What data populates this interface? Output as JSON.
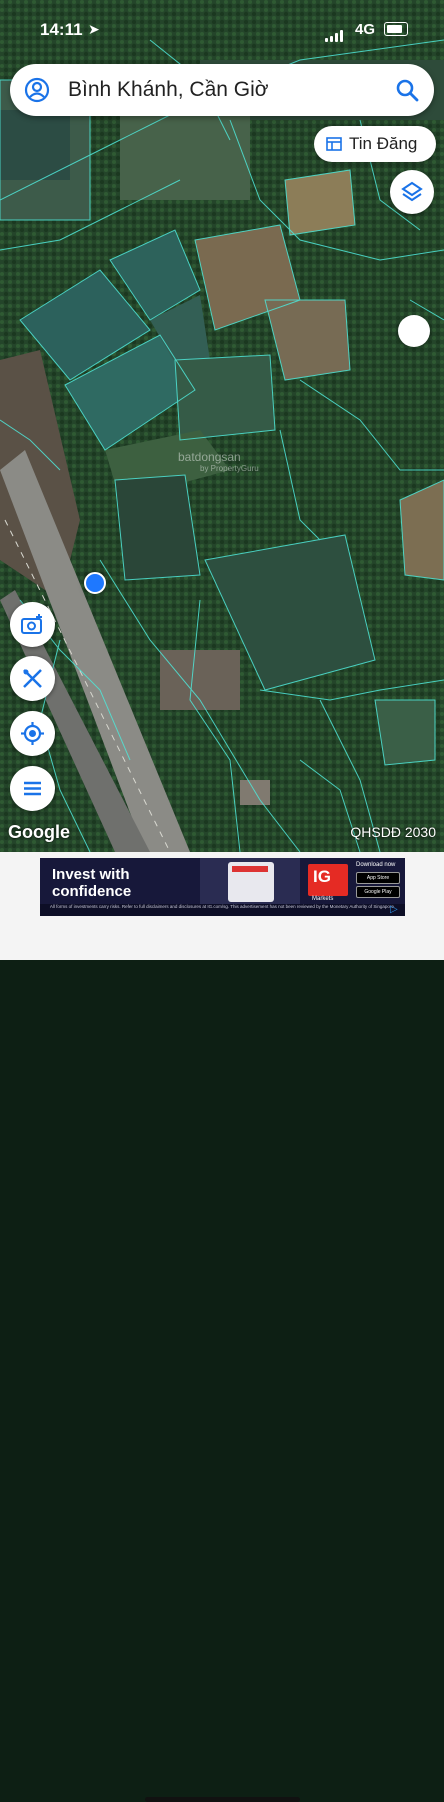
{
  "status_bar": {
    "time": "14:11",
    "network": "4G"
  },
  "search": {
    "query": "Bình Khánh, Cần Giờ"
  },
  "tin_dang_button": {
    "label": "Tin Đăng"
  },
  "map": {
    "attribution": "Google",
    "overlay_label": "QHSDĐ 2030",
    "watermark": "batdongsan",
    "watermark_sub": "by PropertyGuru",
    "boundary_color": "#4fe6d8"
  },
  "fabs": [
    {
      "name": "camera-add-icon"
    },
    {
      "name": "measure-tool-icon"
    },
    {
      "name": "my-location-icon"
    },
    {
      "name": "menu-icon"
    }
  ],
  "ad": {
    "headline": "Invest with confidence",
    "brand": "IG",
    "brand_sub": "Markets",
    "download": "Download now",
    "store_1": "App Store",
    "store_2": "Google Play",
    "disclaimer": "All forms of investments carry risks. Refer to full disclaimers and disclosures at IG.com/sg. This advertisement has not been reviewed by the Monetary Authority of Singapore."
  }
}
